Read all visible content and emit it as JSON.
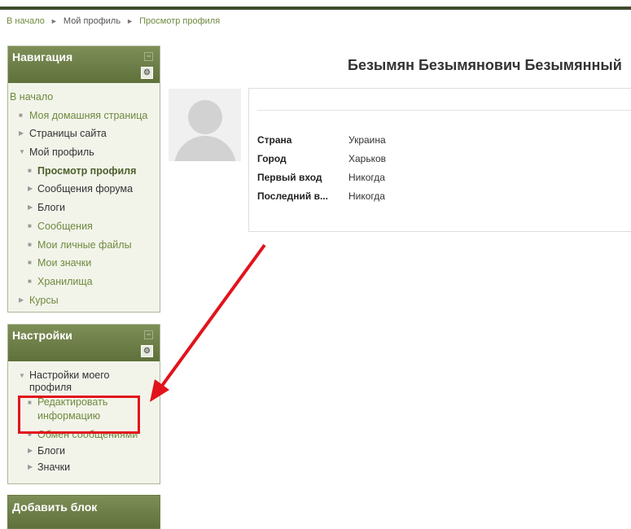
{
  "breadcrumb": [
    "В начало",
    "Мой профиль",
    "Просмотр профиля"
  ],
  "breadcrumb_sep": "►",
  "navigation": {
    "title": "Навигация",
    "items": [
      {
        "label": "В начало",
        "level": 0,
        "marker": ""
      },
      {
        "label": "Моя домашняя страница",
        "level": 1,
        "marker": "■"
      },
      {
        "label": "Страницы сайта",
        "level": 1,
        "marker": "▶"
      },
      {
        "label": "Мой профиль",
        "level": 1,
        "marker": "▼"
      },
      {
        "label": "Просмотр профиля",
        "level": 2,
        "marker": "■"
      },
      {
        "label": "Сообщения форума",
        "level": 2,
        "marker": "▶"
      },
      {
        "label": "Блоги",
        "level": 2,
        "marker": "▶"
      },
      {
        "label": "Сообщения",
        "level": 2,
        "marker": "■"
      },
      {
        "label": "Мои личные файлы",
        "level": 2,
        "marker": "■"
      },
      {
        "label": "Мои значки",
        "level": 2,
        "marker": "■"
      },
      {
        "label": "Хранилища",
        "level": 2,
        "marker": "■"
      },
      {
        "label": "Курсы",
        "level": 1,
        "marker": "▶"
      }
    ]
  },
  "settings": {
    "title": "Настройки",
    "items": [
      {
        "label": "Настройки моего профиля",
        "marker": "▼"
      },
      {
        "label": "Редактировать информацию",
        "marker": "■"
      },
      {
        "label": "Обмен сообщениями",
        "marker": "■"
      },
      {
        "label": "Блоги",
        "marker": "▶"
      },
      {
        "label": "Значки",
        "marker": "▶"
      }
    ]
  },
  "add_block": {
    "title": "Добавить блок"
  },
  "profile": {
    "name": "Безымян Безымянович Безымянный",
    "fields": [
      {
        "label": "Страна",
        "value": "Украина"
      },
      {
        "label": "Город",
        "value": "Харьков"
      },
      {
        "label": "Первый вход",
        "value": "Никогда"
      },
      {
        "label": "Последний в...",
        "value": "Никогда"
      }
    ]
  },
  "icons": {
    "hide": "minus-box-icon",
    "config": "gear-icon"
  },
  "colors": {
    "header_green": "#6b7c46",
    "link_green": "#6f8a3f",
    "highlight_red": "#e2131b"
  }
}
